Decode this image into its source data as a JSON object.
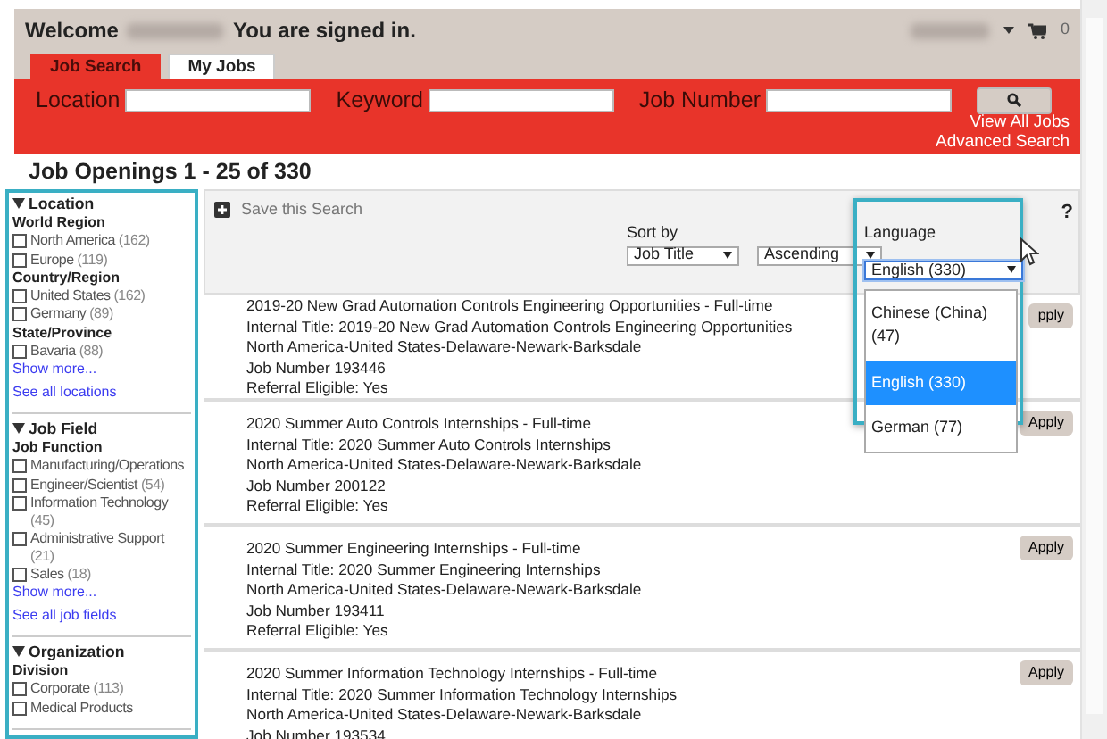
{
  "header": {
    "welcome_prefix": "Welcome",
    "welcome_suffix": "You are signed in.",
    "cart_count": "0"
  },
  "tabs": [
    {
      "label": "Job Search",
      "selected": true
    },
    {
      "label": "My Jobs",
      "selected": false
    }
  ],
  "search_fields": [
    {
      "label": "Location"
    },
    {
      "label": "Keyword"
    },
    {
      "label": "Job Number"
    }
  ],
  "search_links": [
    "View All Jobs",
    "Advanced Search"
  ],
  "results_heading": "Job Openings 1 - 25 of 330",
  "filters": [
    {
      "title": "Location",
      "expanded": true,
      "groups": [
        {
          "title": "World Region",
          "options": [
            {
              "label": "North America",
              "count": "(162)",
              "checked": false
            },
            {
              "label": "Europe",
              "count": "(119)",
              "checked": false
            }
          ]
        },
        {
          "title": "Country/Region",
          "options": [
            {
              "label": "United States",
              "count": "(162)",
              "checked": false
            },
            {
              "label": "Germany",
              "count": "(89)",
              "checked": false
            }
          ]
        },
        {
          "title": "State/Province",
          "options": [
            {
              "label": "Bavaria",
              "count": "(88)",
              "checked": false
            }
          ]
        }
      ],
      "links": [
        "Show more...",
        "See all locations"
      ]
    },
    {
      "title": "Job Field",
      "expanded": true,
      "groups": [
        {
          "title": "Job Function",
          "options": [
            {
              "label": "Manufacturing/Operations",
              "checked": false
            },
            {
              "label": "Engineer/Scientist",
              "count": "(54)",
              "checked": false
            },
            {
              "label": "Information Technology",
              "count": "(45)",
              "checked": false
            },
            {
              "label": "Administrative Support",
              "count": "(21)",
              "checked": false
            },
            {
              "label": "Sales",
              "count": "(18)",
              "checked": false
            }
          ]
        }
      ],
      "links": [
        "Show more...",
        "See all job fields"
      ]
    },
    {
      "title": "Organization",
      "expanded": true,
      "groups": [
        {
          "title": "Division",
          "options": [
            {
              "label": "Corporate",
              "count": "(113)",
              "checked": false
            },
            {
              "label": "Medical Products",
              "checked": false
            }
          ]
        }
      ]
    }
  ],
  "toolbar": {
    "save_label": "Save this Search",
    "sort_label": "Sort by",
    "sort_selects": [
      {
        "value": "Job Title"
      },
      {
        "value": "Ascending"
      }
    ],
    "help": "?",
    "language": {
      "label": "Language",
      "value": "English (330)",
      "expanded": true,
      "options": [
        {
          "label": "Chinese (China) (47)",
          "selected": false
        },
        {
          "label": "English (330)",
          "selected": true
        },
        {
          "label": "German (77)",
          "selected": false
        }
      ]
    }
  },
  "jobs": [
    {
      "title": "2019-20 New Grad Automation Controls Engineering Opportunities",
      "suffix": "- Full-time",
      "lines": [
        "Internal Title: 2019-20 New Grad Automation Controls Engineering Opportunities",
        "North America-United States-Delaware-Newark-Barksdale",
        "Job Number 193446",
        "Referral Eligible: Yes"
      ],
      "apply": "pply"
    },
    {
      "title": "2020 Summer Auto Controls Internships",
      "suffix": "- Full-time",
      "lines": [
        "Internal Title: 2020 Summer Auto Controls Internships",
        "North America-United States-Delaware-Newark-Barksdale",
        "Job Number 200122",
        "Referral Eligible: Yes"
      ],
      "apply": "Apply"
    },
    {
      "title": "2020 Summer Engineering Internships",
      "suffix": "- Full-time",
      "lines": [
        "Internal Title: 2020 Summer Engineering Internships",
        "North America-United States-Delaware-Newark-Barksdale",
        "Job Number 193411",
        "Referral Eligible: Yes"
      ],
      "apply": "Apply"
    },
    {
      "title": "2020 Summer Information Technology Internships",
      "suffix": "- Full-time",
      "lines": [
        "Internal Title: 2020 Summer Information Technology Internships",
        "North America-United States-Delaware-Newark-Barksdale",
        "Job Number 193534"
      ],
      "apply": "Apply"
    }
  ]
}
